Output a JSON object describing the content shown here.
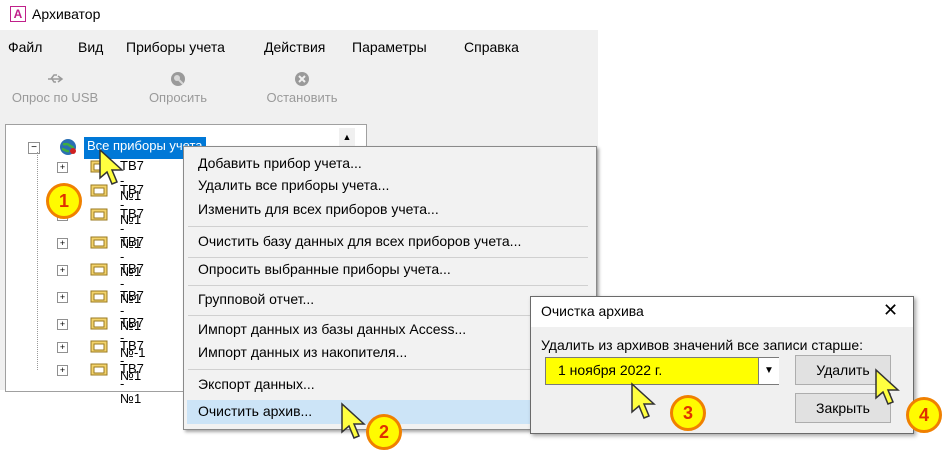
{
  "app": {
    "title": "Архиватор",
    "icon_letter": "A"
  },
  "menu": [
    "Файл",
    "Вид",
    "Приборы учета",
    "Действия",
    "Параметры",
    "Справка"
  ],
  "toolbar": [
    {
      "label": "Опрос по USB",
      "icon": "usb-icon"
    },
    {
      "label": "Опросить",
      "icon": "poll-icon"
    },
    {
      "label": "Остановить",
      "icon": "stop-icon"
    }
  ],
  "tree": {
    "root_label": "Все приборы учета",
    "items": [
      "ТВ7 - №1",
      "ТВ7 - №1",
      "ТВ7 - №1",
      "ТВ7 - №1",
      "ТВ7 - №1",
      "ТВ7 - №1",
      "ТВ7 - №-1",
      "ТВ7 - №1",
      "ТВ7 - №1"
    ]
  },
  "context_menu": {
    "items": [
      "Добавить прибор учета...",
      "Удалить все приборы учета...",
      "Изменить для всех приборов учета...",
      "Очистить базу данных для всех приборов учета...",
      "Опросить выбранные приборы учета...",
      "Групповой отчет...",
      "Импорт данных из базы данных Access...",
      "Импорт данных из накопителя...",
      "Экспорт данных...",
      "Очистить архив..."
    ],
    "highlighted": "Очистить архив..."
  },
  "dialog": {
    "title": "Очистка архива",
    "close": "✕",
    "prompt": "Удалить из архивов значений все записи старше:",
    "date_value": "1   ноября   2022 г.",
    "delete_label": "Удалить",
    "close_label": "Закрыть"
  },
  "badges": [
    "1",
    "2",
    "3",
    "4"
  ],
  "colors": {
    "selection": "#0078d7",
    "highlight": "#cce4f7",
    "badge_fill": "#fffb00",
    "badge_border": "#f08000",
    "date_field": "#ffff00"
  }
}
